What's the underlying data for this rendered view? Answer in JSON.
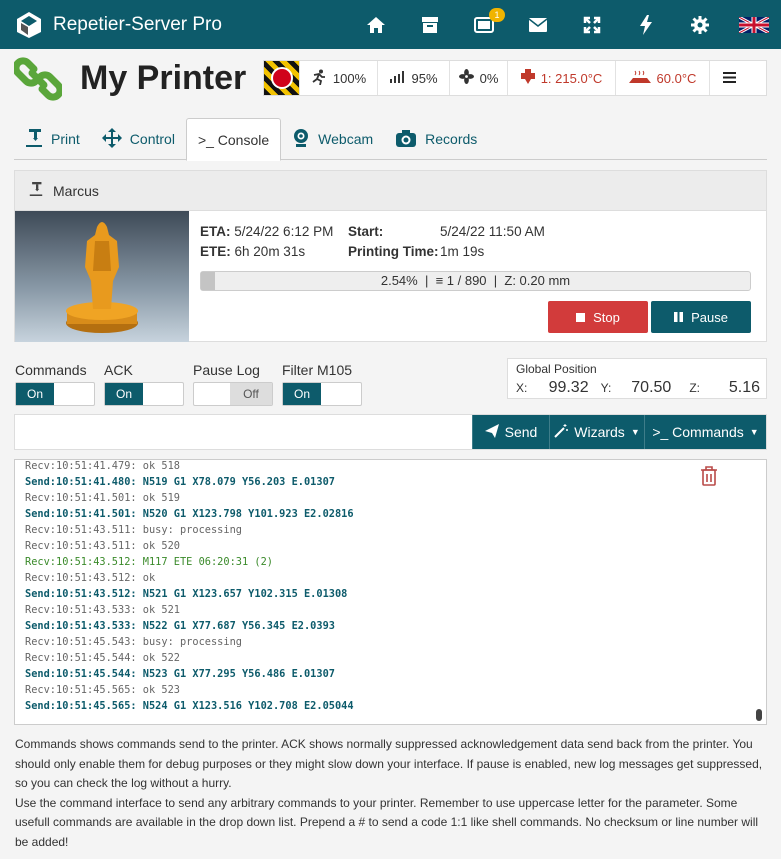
{
  "app": {
    "title": "Repetier-Server Pro"
  },
  "nav": {
    "items": [
      {
        "icon": "home-icon"
      },
      {
        "icon": "archive-icon"
      },
      {
        "icon": "tablet-icon",
        "badge": "1"
      },
      {
        "icon": "mail-icon"
      },
      {
        "icon": "fullscreen-icon"
      },
      {
        "icon": "bolt-icon"
      },
      {
        "icon": "gear-icon"
      },
      {
        "icon": "uk-flag-icon"
      }
    ]
  },
  "printer": {
    "name": "My Printer",
    "speed": "100%",
    "flow": "95%",
    "fan": "0%",
    "extruder": "1: 215.0°C",
    "bed": "60.0°C"
  },
  "tabs": [
    {
      "label": "Print"
    },
    {
      "label": "Control"
    },
    {
      "label": ">_ Console"
    },
    {
      "label": "Webcam"
    },
    {
      "label": "Records"
    }
  ],
  "job": {
    "name": "Marcus",
    "eta_label": "ETA:",
    "eta": "5/24/22 6:12 PM",
    "ete_label": "ETE:",
    "ete": "6h 20m 31s",
    "start_label": "Start:",
    "start": "5/24/22 11:50 AM",
    "ptime_label": "Printing Time:",
    "ptime": "1m 19s",
    "progress_percent": 2.54,
    "progress_text": "2.54%",
    "layer_text": "1 / 890",
    "z_text": "Z: 0.20 mm",
    "stop_label": "Stop",
    "pause_label": "Pause"
  },
  "toggles": {
    "commands": {
      "label": "Commands",
      "state": "On"
    },
    "ack": {
      "label": "ACK",
      "state": "On"
    },
    "pause_log": {
      "label": "Pause Log",
      "state": "Off"
    },
    "filter": {
      "label": "Filter M105",
      "state": "On"
    }
  },
  "position": {
    "title": "Global Position",
    "x_label": "X:",
    "x": "99.32",
    "y_label": "Y:",
    "y": "70.50",
    "z_label": "Z:",
    "z": "5.16"
  },
  "command": {
    "placeholder": "",
    "send_label": "Send",
    "wizards_label": "Wizards",
    "commands_label": ">_ Commands"
  },
  "console": {
    "lines": [
      {
        "type": "recv",
        "text": "Recv:10:51:41.479: ok 518"
      },
      {
        "type": "send",
        "text": "Send:10:51:41.480: N519 G1 X78.079 Y56.203 E.01307"
      },
      {
        "type": "recv",
        "text": "Recv:10:51:41.501: ok 519"
      },
      {
        "type": "send",
        "text": "Send:10:51:41.501: N520 G1 X123.798 Y101.923 E2.02816"
      },
      {
        "type": "recv",
        "text": "Recv:10:51:43.511: busy: processing"
      },
      {
        "type": "recv",
        "text": "Recv:10:51:43.511: ok 520"
      },
      {
        "type": "green",
        "text": "Recv:10:51:43.512: M117 ETE 06:20:31 (2)"
      },
      {
        "type": "recv",
        "text": "Recv:10:51:43.512: ok"
      },
      {
        "type": "send",
        "text": "Send:10:51:43.512: N521 G1 X123.657 Y102.315 E.01308"
      },
      {
        "type": "recv",
        "text": "Recv:10:51:43.533: ok 521"
      },
      {
        "type": "send",
        "text": "Send:10:51:43.533: N522 G1 X77.687 Y56.345 E2.0393"
      },
      {
        "type": "recv",
        "text": "Recv:10:51:45.543: busy: processing"
      },
      {
        "type": "recv",
        "text": "Recv:10:51:45.544: ok 522"
      },
      {
        "type": "send",
        "text": "Send:10:51:45.544: N523 G1 X77.295 Y56.486 E.01307"
      },
      {
        "type": "recv",
        "text": "Recv:10:51:45.565: ok 523"
      },
      {
        "type": "send",
        "text": "Send:10:51:45.565: N524 G1 X123.516 Y102.708 E2.05044"
      }
    ]
  },
  "help": {
    "p1": "Commands shows commands send to the printer. ACK shows normally suppressed acknowledgement data send back from the printer. You should only enable them for debug purposes or they might slow down your interface. If pause is enabled, new log messages get suppressed, so you can check the log without a hurry.",
    "p2": "Use the command interface to send any arbitrary commands to your printer. Remember to use uppercase letter for the parameter. Some usefull commands are available in the drop down list. Prepend a # to send a code 1:1 like shell commands. No checksum or line number will be added!"
  },
  "colors": {
    "primary": "#0d5b6b",
    "danger": "#d23b3b",
    "badge": "#f0b400",
    "chain": "#5aa63a"
  }
}
